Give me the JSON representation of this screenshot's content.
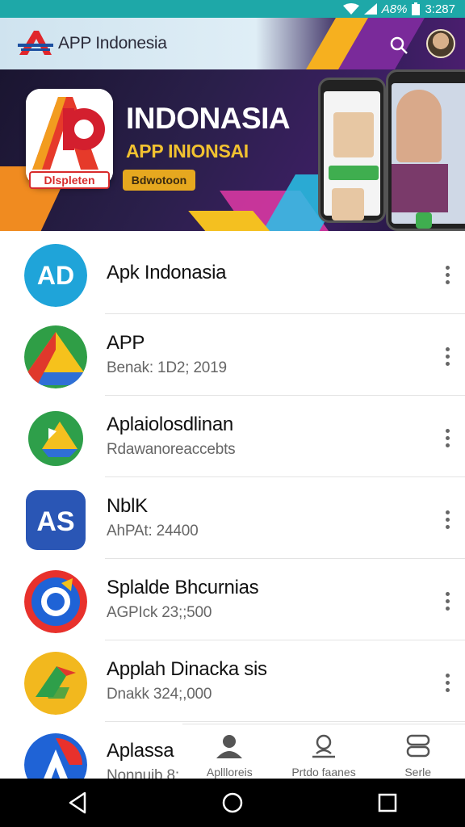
{
  "status_bar": {
    "battery_text": "A8%",
    "time": "3:287"
  },
  "header": {
    "title": "APP Indonesia",
    "icons": [
      "search-icon",
      "avatar"
    ]
  },
  "banner": {
    "headline": "INDONASIA",
    "subheadline": "APP INIONSAI",
    "logo_label": "Dlspleten",
    "pill_label": "Bdwotoon"
  },
  "apps": [
    {
      "title": "Apk Indonasia",
      "subtitle": "",
      "icon": "ad-app-icon"
    },
    {
      "title": "APP",
      "subtitle": "Benak: 1D2; 2019",
      "icon": "drive-style-app-icon"
    },
    {
      "title": "Aplaiolosdlinan",
      "subtitle": "Rdawanoreaccebts",
      "icon": "arrow-drive-app-icon"
    },
    {
      "title": "NblK",
      "subtitle": "AhPAt: 24400",
      "icon": "as-app-icon"
    },
    {
      "title": "Splalde Bhcurnias",
      "subtitle": "AGPIck 23;;500",
      "icon": "refresh-app-icon"
    },
    {
      "title": "Applah Dinacka sis",
      "subtitle": "Dnakk 324;,000",
      "icon": "yellow-arrow-app-icon"
    },
    {
      "title": "Aplassa",
      "subtitle": "Nonnuib 8:",
      "icon": "a-app-icon"
    }
  ],
  "bottom_nav": [
    {
      "label": "Apllloreis",
      "icon": "person-icon"
    },
    {
      "label": "Prtdo faanes",
      "icon": "profile-outline-icon"
    },
    {
      "label": "Serle",
      "icon": "storage-icon"
    }
  ],
  "colors": {
    "status_bar": "#1ea8a8",
    "accent_red": "#d82b2b",
    "banner_bg": "#2a1f4a",
    "gold": "#f2c230"
  }
}
